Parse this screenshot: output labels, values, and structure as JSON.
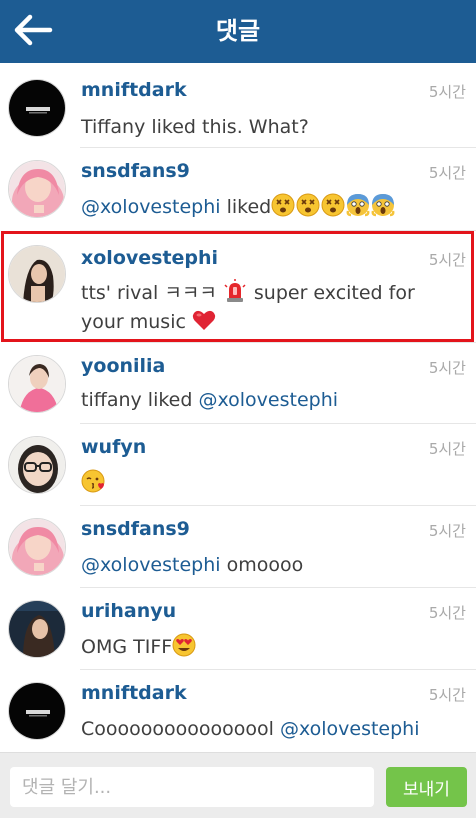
{
  "header": {
    "title": "댓글"
  },
  "comments": [
    {
      "username": "mniftdark",
      "time": "5시간",
      "text": "Tiffany liked this. What?",
      "avatar": "dark-logo-avatar"
    },
    {
      "username": "snsdfans9",
      "time": "5시간",
      "mention": "@xolovestephi",
      "text": " liked",
      "emojis": [
        "dizzy-face-emoji",
        "dizzy-face-emoji",
        "dizzy-face-emoji",
        "screaming-face-emoji",
        "screaming-face-emoji"
      ],
      "avatar": "pink-hair-avatar"
    },
    {
      "username": "xolovestephi",
      "time": "5시간",
      "text_part1": "tts' rival ㅋㅋㅋ ",
      "text_part2": " super excited for your music ",
      "emojis": [
        "siren-emoji",
        "red-heart-emoji"
      ],
      "avatar": "portrait-avatar"
    },
    {
      "username": "yoonilia",
      "time": "5시간",
      "text": "tiffany liked ",
      "mention": "@xolovestephi",
      "avatar": "pink-jacket-avatar"
    },
    {
      "username": "wufyn",
      "time": "5시간",
      "emojis": [
        "kissing-face-emoji"
      ],
      "avatar": "glasses-avatar"
    },
    {
      "username": "snsdfans9",
      "time": "5시간",
      "mention": "@xolovestephi",
      "text": " omoooo",
      "avatar": "pink-hair-avatar"
    },
    {
      "username": "urihanyu",
      "time": "5시간",
      "text": "OMG TIFF",
      "emojis": [
        "heart-eyes-emoji"
      ],
      "avatar": "dark-portrait-avatar"
    },
    {
      "username": "mniftdark",
      "time": "5시간",
      "text": "Coooooooooooooool ",
      "mention": "@xolovestephi",
      "avatar": "dark-logo-avatar"
    }
  ],
  "footer": {
    "input_placeholder": "댓글 달기...",
    "send_label": "보내기"
  },
  "colors": {
    "header_bg": "#1d5c93",
    "username": "#1d5c93",
    "highlight": "#e3141b",
    "send_button": "#74c44a"
  }
}
